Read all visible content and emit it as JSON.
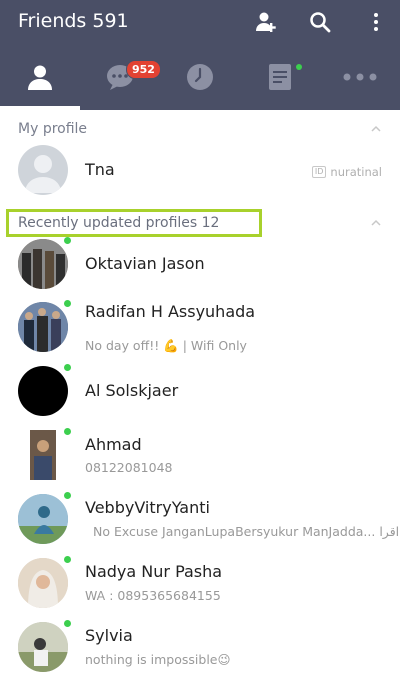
{
  "header": {
    "title": "Friends 591",
    "add_friend_icon": "add-friend-icon",
    "search_icon": "search-icon",
    "more_icon": "more-vertical-icon"
  },
  "tabs": [
    {
      "name": "friends",
      "icon": "person-icon",
      "active": true
    },
    {
      "name": "chats",
      "icon": "chat-bubble-icon",
      "badge": "952"
    },
    {
      "name": "timeline",
      "icon": "clock-icon"
    },
    {
      "name": "news",
      "icon": "document-icon",
      "dot": true
    },
    {
      "name": "more",
      "icon": "more-horizontal-icon"
    }
  ],
  "my_profile": {
    "section_label": "My profile",
    "name": "Tna",
    "id_label": "ID",
    "id_value": "nuratinal"
  },
  "recent": {
    "section_label": "Recently updated profiles 12",
    "items": [
      {
        "name": "Oktavian Jason",
        "status": ""
      },
      {
        "name": "Radifan H Assyuhada",
        "status": "No day off!! 💪 | Wifi Only"
      },
      {
        "name": "Al Solskjaer",
        "status": ""
      },
      {
        "name": "Ahmad",
        "status": "08122081048"
      },
      {
        "name": "VebbyVitryYanti",
        "status": "No Excuse JanganLupaBersyukur ManJadda... اقرا"
      },
      {
        "name": "Nadya Nur Pasha",
        "status": "WA : 0895365684155"
      },
      {
        "name": "Sylvia",
        "status": "nothing is impossible😉"
      }
    ]
  },
  "colors": {
    "bar": "#4a4f66",
    "badge": "#e24232",
    "online": "#3ccf4e",
    "highlight": "#a8d12c"
  }
}
